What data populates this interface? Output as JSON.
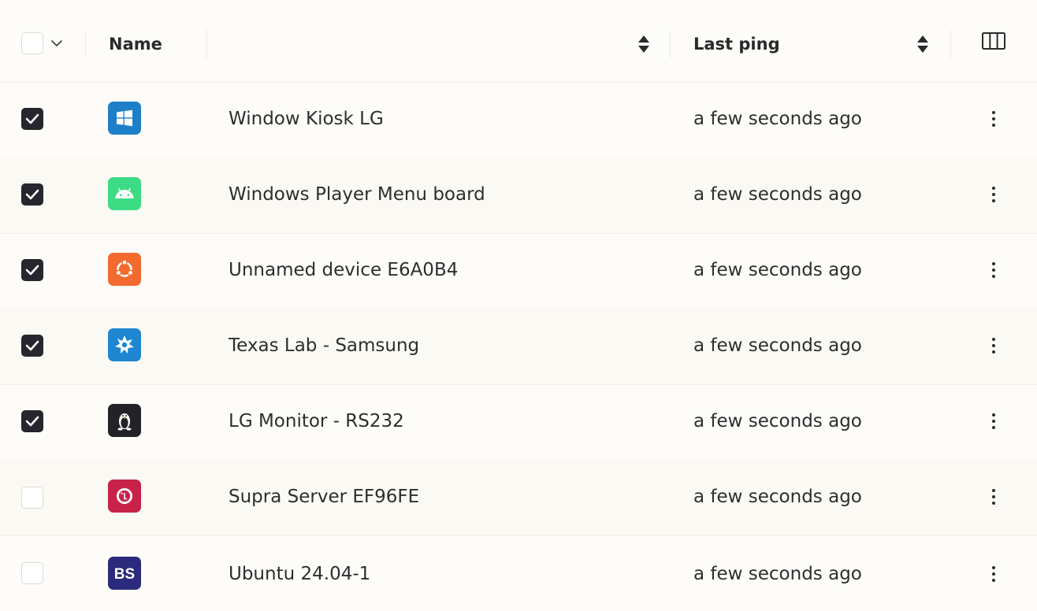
{
  "header": {
    "name_label": "Name",
    "last_ping_label": "Last ping"
  },
  "rows": [
    {
      "checked": true,
      "os": "windows-icon",
      "name": "Window Kiosk LG",
      "last_ping": "a few seconds ago"
    },
    {
      "checked": true,
      "os": "android-icon",
      "name": "Windows Player Menu board",
      "last_ping": "a few seconds ago"
    },
    {
      "checked": true,
      "os": "ubuntu-icon",
      "name": "Unnamed device E6A0B4",
      "last_ping": "a few seconds ago"
    },
    {
      "checked": true,
      "os": "tizen-icon",
      "name": "Texas Lab - Samsung",
      "last_ping": "a few seconds ago"
    },
    {
      "checked": true,
      "os": "linux-icon",
      "name": "LG Monitor - RS232",
      "last_ping": "a few seconds ago"
    },
    {
      "checked": false,
      "os": "lg-webos-icon",
      "name": "Supra Server EF96FE",
      "last_ping": "a few seconds ago"
    },
    {
      "checked": false,
      "os": "brightsign-icon",
      "name": "Ubuntu 24.04-1",
      "last_ping": "a few seconds ago"
    }
  ],
  "icons": {
    "brightsign_text": "BS"
  },
  "colors": {
    "windows": "#1e7fc8",
    "android": "#3ddc84",
    "ubuntu": "#f26a2e",
    "tizen": "#1f86d1",
    "linux": "#222326",
    "lg": "#c8224a",
    "brightsign": "#2b2a7c",
    "checkbox_checked": "#25272d"
  }
}
